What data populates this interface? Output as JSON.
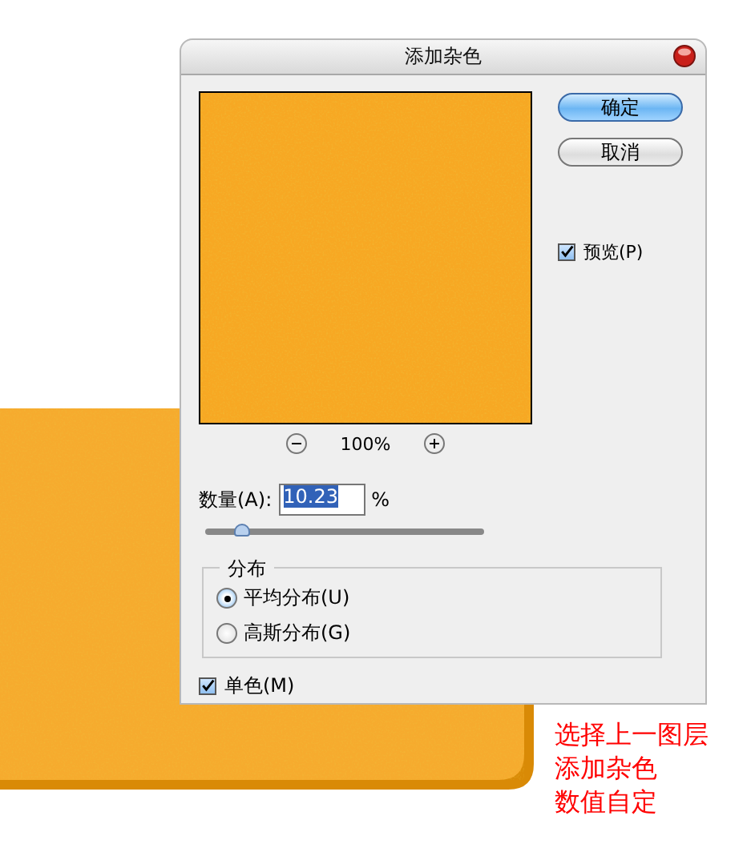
{
  "dialog": {
    "title": "添加杂色",
    "buttons": [
      {
        "label": "确定",
        "kind": "default"
      },
      {
        "label": "取消",
        "kind": "normal"
      }
    ],
    "preview": {
      "label": "预览(P)",
      "checked": true
    },
    "zoom": "100%",
    "amount": {
      "label": "数量(A):",
      "value": "10.23",
      "unit": "%",
      "level": 0.13
    },
    "distribution": {
      "title": "分布",
      "options": [
        {
          "label": "平均分布(U)",
          "selected": true
        },
        {
          "label": "高斯分布(G)",
          "selected": false
        }
      ]
    },
    "monochrome": {
      "label": "单色(M)",
      "checked": true
    }
  },
  "annotation": [
    "选择上一图层",
    "添加杂色",
    "数值自定"
  ]
}
